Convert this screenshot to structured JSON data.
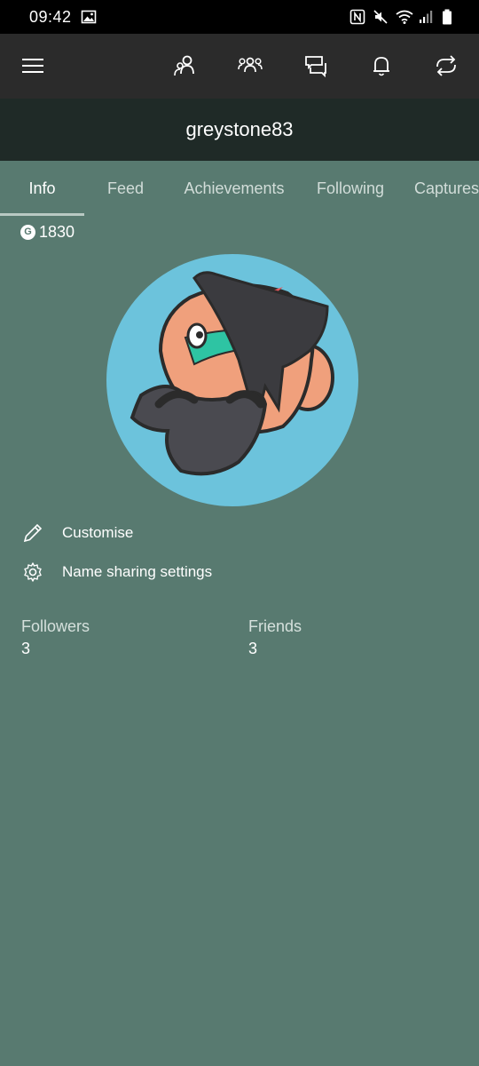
{
  "status_bar": {
    "time": "09:42",
    "icons": [
      "image-icon",
      "nfc-icon",
      "mute-icon",
      "wifi-icon",
      "signal-icon",
      "battery-icon"
    ]
  },
  "app_bar": {
    "icons": [
      "menu-icon",
      "friends-icon",
      "party-icon",
      "messages-icon",
      "notifications-icon",
      "sync-icon"
    ]
  },
  "profile": {
    "gamertag": "greystone83",
    "gamerscore_badge": "G",
    "gamerscore": "1830"
  },
  "tabs": [
    {
      "label": "Info",
      "active": true
    },
    {
      "label": "Feed",
      "active": false
    },
    {
      "label": "Achievements",
      "active": false
    },
    {
      "label": "Following",
      "active": false
    },
    {
      "label": "Captures",
      "active": false
    }
  ],
  "actions": {
    "customise": "Customise",
    "name_sharing": "Name sharing settings"
  },
  "stats": {
    "followers_label": "Followers",
    "followers_value": "3",
    "friends_label": "Friends",
    "friends_value": "3"
  },
  "colors": {
    "background": "#587a70",
    "app_bar": "#2b2b2b",
    "title_bar": "#1f2a27",
    "avatar_bg": "#6cc3dc"
  }
}
